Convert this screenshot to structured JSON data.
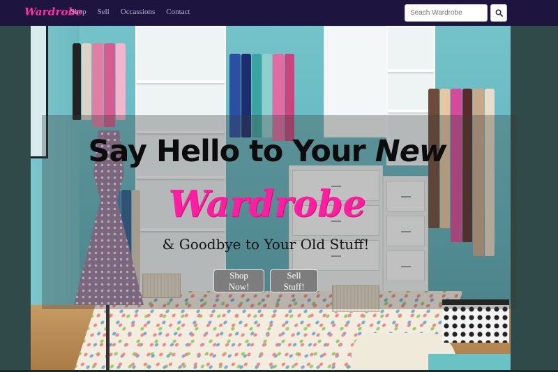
{
  "navbar": {
    "brand": "Wardrobe",
    "links": [
      "Shop",
      "Sell",
      "Occassions",
      "Contact"
    ],
    "search": {
      "placeholder": "Seach Wardrobe",
      "value": ""
    },
    "search_button_icon": "search-icon"
  },
  "hero": {
    "headline_start": "Say Hello to Your ",
    "headline_emph": "New",
    "brand_big": "Wardrobe",
    "subline": "& Goodbye to Your Old Stuff!",
    "buttons": {
      "shop": "Shop Now!",
      "sell": "Sell Stuff!"
    }
  },
  "colors": {
    "navbar_bg": "#1e1440",
    "brand_pink": "#ff2fa8",
    "page_bg": "#2f4a48",
    "button_bg": "#7d7d7d"
  }
}
